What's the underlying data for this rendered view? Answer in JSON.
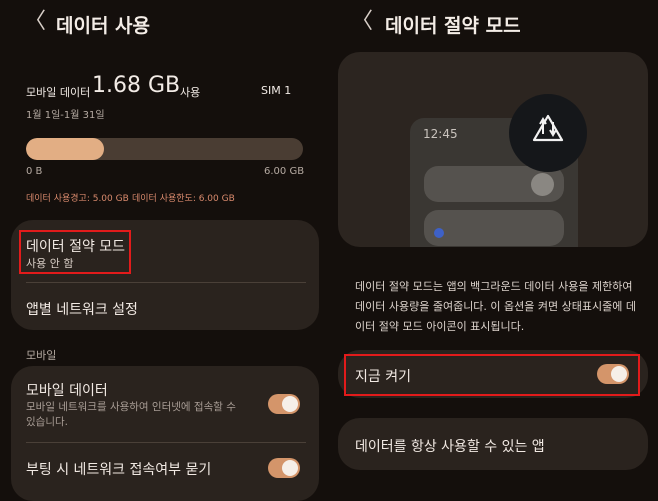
{
  "left": {
    "back_glyph": "〈",
    "title": "데이터 사용",
    "usage": {
      "label": "모바일 데이터",
      "amount": "1.68 GB",
      "unit": "사용",
      "sim": "SIM 1",
      "period": "1월 1일-1월 31일",
      "bar_fraction": 0.28,
      "scale_min": "0 B",
      "scale_max": "6.00 GB",
      "warning": "데이터 사용경고: 5.00 GB",
      "limit": "데이터 사용한도: 6.00 GB"
    },
    "saver_card": {
      "saver_title": "데이터 절약 모드",
      "saver_status": "사용 안 함",
      "app_network": "앱별 네트워크 설정"
    },
    "mobile_section": {
      "header": "모바일",
      "mobile_data_title": "모바일 데이터",
      "mobile_data_desc": "모바일 네트워크를 사용하여 인터넷에 접속할 수 있습니다.",
      "boot_ask": "부팅 시 네트워크 접속여부 묻기"
    }
  },
  "right": {
    "back_glyph": "〈",
    "title": "데이터 절약 모드",
    "illustration": {
      "phone_time": "12:45",
      "icon": "data-saver-icon"
    },
    "description": "데이터 절약 모드는 앱의 백그라운드 데이터 사용을 제한하여 데이터 사용량을 줄여줍니다. 이 옵션을 켜면 상태표시줄에 데이터 절약 모드 아이콘이 표시됩니다.",
    "turn_on_now": "지금 켜기",
    "always_allowed_apps": "데이터를 항상 사용할 수 있는 앱"
  },
  "colors": {
    "background": "#140f0c",
    "card": "#2a231e",
    "accent": "#d4956a",
    "highlight_box": "#e21b1b",
    "warning_text": "#d98a6d"
  }
}
